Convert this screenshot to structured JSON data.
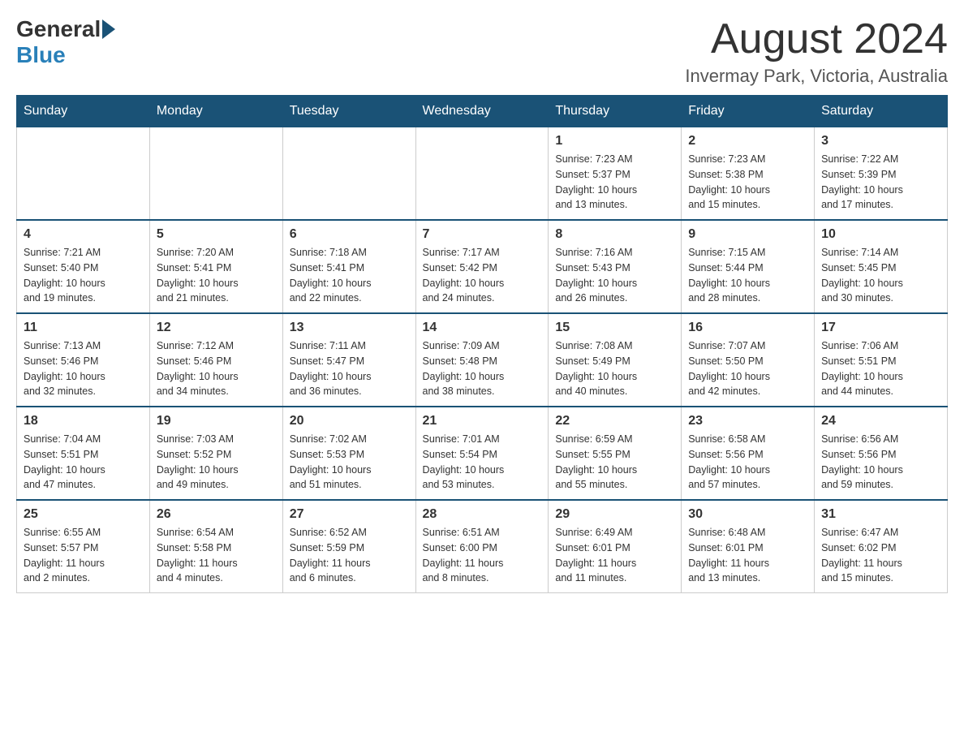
{
  "logo": {
    "general": "General",
    "blue": "Blue"
  },
  "title": "August 2024",
  "location": "Invermay Park, Victoria, Australia",
  "days_of_week": [
    "Sunday",
    "Monday",
    "Tuesday",
    "Wednesday",
    "Thursday",
    "Friday",
    "Saturday"
  ],
  "weeks": [
    [
      {
        "day": "",
        "info": ""
      },
      {
        "day": "",
        "info": ""
      },
      {
        "day": "",
        "info": ""
      },
      {
        "day": "",
        "info": ""
      },
      {
        "day": "1",
        "info": "Sunrise: 7:23 AM\nSunset: 5:37 PM\nDaylight: 10 hours\nand 13 minutes."
      },
      {
        "day": "2",
        "info": "Sunrise: 7:23 AM\nSunset: 5:38 PM\nDaylight: 10 hours\nand 15 minutes."
      },
      {
        "day": "3",
        "info": "Sunrise: 7:22 AM\nSunset: 5:39 PM\nDaylight: 10 hours\nand 17 minutes."
      }
    ],
    [
      {
        "day": "4",
        "info": "Sunrise: 7:21 AM\nSunset: 5:40 PM\nDaylight: 10 hours\nand 19 minutes."
      },
      {
        "day": "5",
        "info": "Sunrise: 7:20 AM\nSunset: 5:41 PM\nDaylight: 10 hours\nand 21 minutes."
      },
      {
        "day": "6",
        "info": "Sunrise: 7:18 AM\nSunset: 5:41 PM\nDaylight: 10 hours\nand 22 minutes."
      },
      {
        "day": "7",
        "info": "Sunrise: 7:17 AM\nSunset: 5:42 PM\nDaylight: 10 hours\nand 24 minutes."
      },
      {
        "day": "8",
        "info": "Sunrise: 7:16 AM\nSunset: 5:43 PM\nDaylight: 10 hours\nand 26 minutes."
      },
      {
        "day": "9",
        "info": "Sunrise: 7:15 AM\nSunset: 5:44 PM\nDaylight: 10 hours\nand 28 minutes."
      },
      {
        "day": "10",
        "info": "Sunrise: 7:14 AM\nSunset: 5:45 PM\nDaylight: 10 hours\nand 30 minutes."
      }
    ],
    [
      {
        "day": "11",
        "info": "Sunrise: 7:13 AM\nSunset: 5:46 PM\nDaylight: 10 hours\nand 32 minutes."
      },
      {
        "day": "12",
        "info": "Sunrise: 7:12 AM\nSunset: 5:46 PM\nDaylight: 10 hours\nand 34 minutes."
      },
      {
        "day": "13",
        "info": "Sunrise: 7:11 AM\nSunset: 5:47 PM\nDaylight: 10 hours\nand 36 minutes."
      },
      {
        "day": "14",
        "info": "Sunrise: 7:09 AM\nSunset: 5:48 PM\nDaylight: 10 hours\nand 38 minutes."
      },
      {
        "day": "15",
        "info": "Sunrise: 7:08 AM\nSunset: 5:49 PM\nDaylight: 10 hours\nand 40 minutes."
      },
      {
        "day": "16",
        "info": "Sunrise: 7:07 AM\nSunset: 5:50 PM\nDaylight: 10 hours\nand 42 minutes."
      },
      {
        "day": "17",
        "info": "Sunrise: 7:06 AM\nSunset: 5:51 PM\nDaylight: 10 hours\nand 44 minutes."
      }
    ],
    [
      {
        "day": "18",
        "info": "Sunrise: 7:04 AM\nSunset: 5:51 PM\nDaylight: 10 hours\nand 47 minutes."
      },
      {
        "day": "19",
        "info": "Sunrise: 7:03 AM\nSunset: 5:52 PM\nDaylight: 10 hours\nand 49 minutes."
      },
      {
        "day": "20",
        "info": "Sunrise: 7:02 AM\nSunset: 5:53 PM\nDaylight: 10 hours\nand 51 minutes."
      },
      {
        "day": "21",
        "info": "Sunrise: 7:01 AM\nSunset: 5:54 PM\nDaylight: 10 hours\nand 53 minutes."
      },
      {
        "day": "22",
        "info": "Sunrise: 6:59 AM\nSunset: 5:55 PM\nDaylight: 10 hours\nand 55 minutes."
      },
      {
        "day": "23",
        "info": "Sunrise: 6:58 AM\nSunset: 5:56 PM\nDaylight: 10 hours\nand 57 minutes."
      },
      {
        "day": "24",
        "info": "Sunrise: 6:56 AM\nSunset: 5:56 PM\nDaylight: 10 hours\nand 59 minutes."
      }
    ],
    [
      {
        "day": "25",
        "info": "Sunrise: 6:55 AM\nSunset: 5:57 PM\nDaylight: 11 hours\nand 2 minutes."
      },
      {
        "day": "26",
        "info": "Sunrise: 6:54 AM\nSunset: 5:58 PM\nDaylight: 11 hours\nand 4 minutes."
      },
      {
        "day": "27",
        "info": "Sunrise: 6:52 AM\nSunset: 5:59 PM\nDaylight: 11 hours\nand 6 minutes."
      },
      {
        "day": "28",
        "info": "Sunrise: 6:51 AM\nSunset: 6:00 PM\nDaylight: 11 hours\nand 8 minutes."
      },
      {
        "day": "29",
        "info": "Sunrise: 6:49 AM\nSunset: 6:01 PM\nDaylight: 11 hours\nand 11 minutes."
      },
      {
        "day": "30",
        "info": "Sunrise: 6:48 AM\nSunset: 6:01 PM\nDaylight: 11 hours\nand 13 minutes."
      },
      {
        "day": "31",
        "info": "Sunrise: 6:47 AM\nSunset: 6:02 PM\nDaylight: 11 hours\nand 15 minutes."
      }
    ]
  ]
}
